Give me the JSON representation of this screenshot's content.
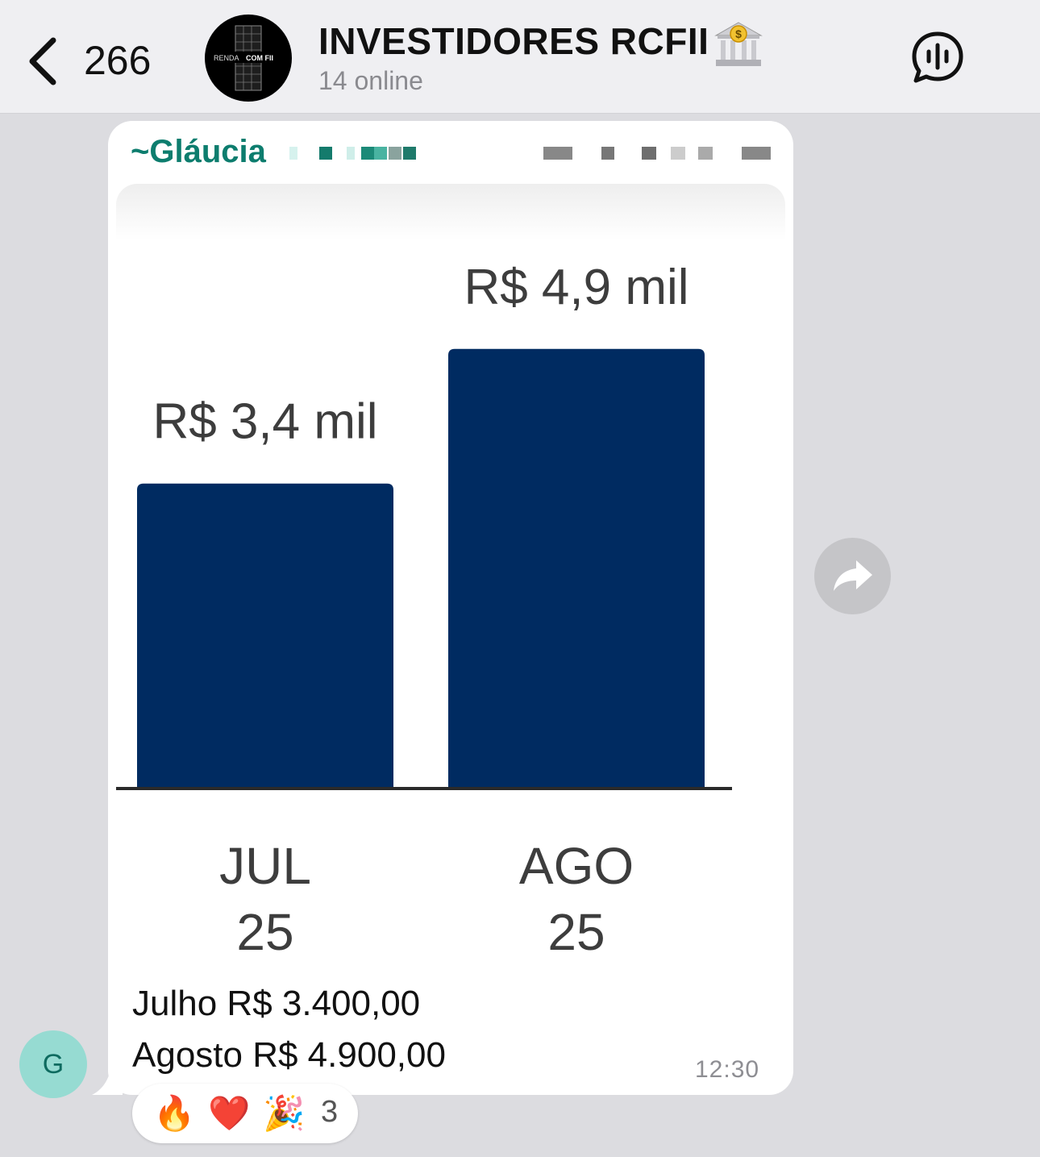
{
  "header": {
    "back_count": "266",
    "group_avatar_text_left": "RENDA",
    "group_avatar_text_right": "COM FII",
    "title": "INVESTIDORES RCFII",
    "title_emoji": "bank-dollar-icon",
    "subtitle": "14 online",
    "voice_chat_icon": "voice-chat-icon"
  },
  "message": {
    "sender_prefix": "~",
    "sender_name": "Gláucia",
    "caption_lines": [
      "Julho R$ 3.400,00",
      "Agosto R$ 4.900,00"
    ],
    "time": "12:30",
    "sender_avatar_letter": "G",
    "reactions": [
      "🔥",
      "❤️",
      "🎉"
    ],
    "reaction_count": "3",
    "forward_icon": "forward-arrow-icon"
  },
  "colors": {
    "bar": "#002b61",
    "sender_name": "#0d7d6e",
    "avatar_bg": "#96dbd2",
    "background": "#dcdce0"
  },
  "chart_data": {
    "type": "bar",
    "categories": [
      [
        "JUL",
        "25"
      ],
      [
        "AGO",
        "25"
      ]
    ],
    "values": [
      3400,
      4900
    ],
    "data_labels": [
      "R$ 3,4 mil",
      "R$ 4,9 mil"
    ],
    "title": "",
    "xlabel": "",
    "ylabel": "",
    "ylim": [
      0,
      7100
    ]
  }
}
